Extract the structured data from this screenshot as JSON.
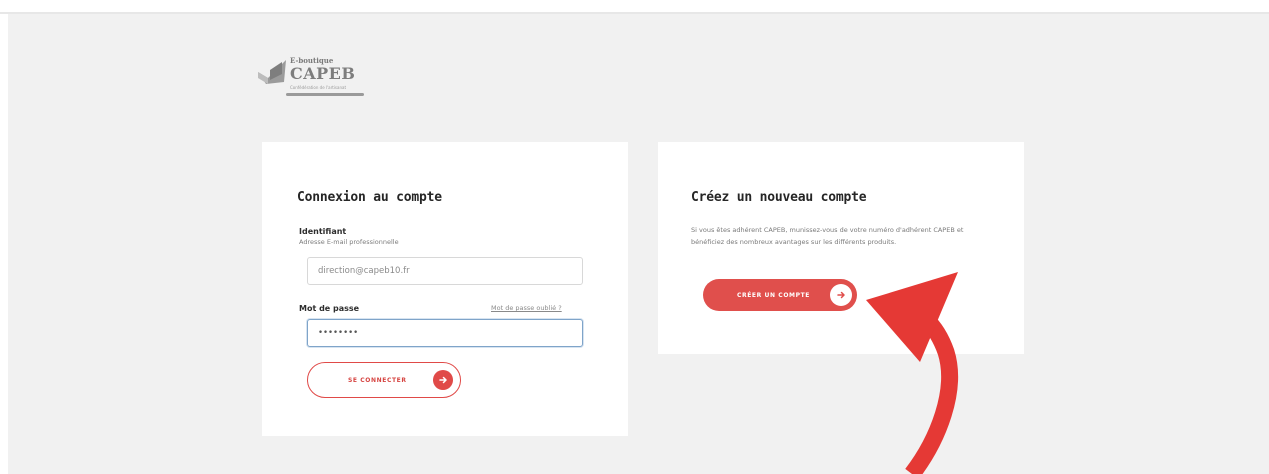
{
  "logo": {
    "kicker": "E-boutique",
    "name": "CAPEB",
    "tagline": "Confédération de l'artisanat"
  },
  "login": {
    "title": "Connexion au compte",
    "identifier_label": "Identifiant",
    "identifier_hint": "Adresse E-mail professionnelle",
    "identifier_value": "direction@capeb10.fr",
    "password_label": "Mot de passe",
    "forgot_link": "Mot de passe oublié ?",
    "password_value": "••••••••",
    "submit_label": "SE CONNECTER"
  },
  "register": {
    "title": "Créez un nouveau compte",
    "description": "Si vous êtes adhérent CAPEB, munissez-vous de votre numéro d'adhérent CAPEB et bénéficiez des nombreux avantages sur les différents produits.",
    "button_label": "CRÉER UN COMPTE"
  },
  "colors": {
    "accent": "#e04f4c",
    "arrow": "#e53935",
    "page_background": "#f1f1f1",
    "card_background": "#ffffff"
  },
  "icons": {
    "login_button": "arrow-right-icon",
    "register_button": "arrow-right-icon",
    "annotation": "curved-arrow-icon"
  }
}
